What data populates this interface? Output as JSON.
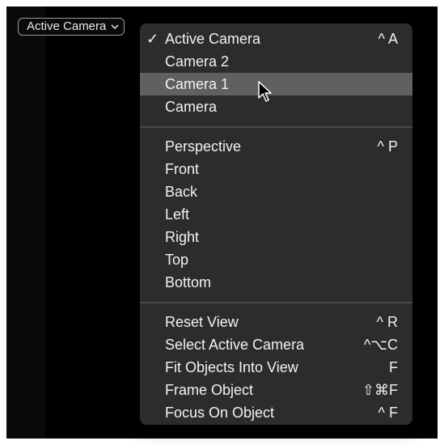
{
  "dropdown": {
    "label": "Active Camera"
  },
  "menu": {
    "groups": [
      [
        {
          "label": "Active Camera",
          "shortcut": "^ A",
          "checked": true
        },
        {
          "label": "Camera 2",
          "shortcut": ""
        },
        {
          "label": "Camera 1",
          "shortcut": "",
          "highlighted": true
        },
        {
          "label": "Camera",
          "shortcut": ""
        }
      ],
      [
        {
          "label": "Perspective",
          "shortcut": "^ P"
        },
        {
          "label": "Front",
          "shortcut": ""
        },
        {
          "label": "Back",
          "shortcut": ""
        },
        {
          "label": "Left",
          "shortcut": ""
        },
        {
          "label": "Right",
          "shortcut": ""
        },
        {
          "label": "Top",
          "shortcut": ""
        },
        {
          "label": "Bottom",
          "shortcut": ""
        }
      ],
      [
        {
          "label": "Reset View",
          "shortcut": "^ R"
        },
        {
          "label": "Select Active Camera",
          "shortcut": "^⌥C"
        },
        {
          "label": "Fit Objects Into View",
          "shortcut": "F"
        },
        {
          "label": "Frame Object",
          "shortcut": "⇧⌘F"
        },
        {
          "label": "Focus On Object",
          "shortcut": "^ F"
        }
      ]
    ]
  },
  "icons": {
    "check": "checkmark-icon",
    "chevron": "chevron-down-icon",
    "cursor": "mouse-pointer-icon"
  },
  "colors": {
    "menu_bg": "#2c2c2c",
    "highlight": "#606060",
    "separator": "#4a4a4a"
  }
}
